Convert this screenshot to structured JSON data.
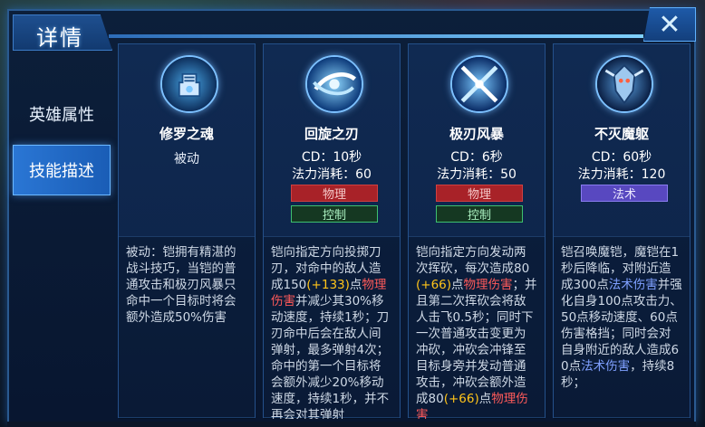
{
  "header": {
    "title": "详情",
    "close_icon": "close-x-icon"
  },
  "sidebar": {
    "tabs": [
      {
        "label": "英雄属性",
        "active": false
      },
      {
        "label": "技能描述",
        "active": true
      }
    ]
  },
  "skills": [
    {
      "name": "修罗之魂",
      "icon": "fist-soul-icon",
      "type": "被动",
      "desc": [
        {
          "t": "被动：铠拥有精湛的战斗技巧，当铠的普通攻击和极刃风暴只命中一个目标时将会额外造成50%伤害"
        }
      ]
    },
    {
      "name": "回旋之刃",
      "icon": "spinning-blade-icon",
      "cd": "CD：10秒",
      "cost": "法力消耗：60",
      "tags": [
        "物理",
        "控制"
      ],
      "desc": [
        {
          "t": "铠向指定方向投掷刀刃，对命中的敌人造成150"
        },
        {
          "t": "(+133)",
          "c": "y"
        },
        {
          "t": "点"
        },
        {
          "t": "物理伤害",
          "c": "r"
        },
        {
          "t": "并减少其30%移动速度，持续1秒；刀刃命中后会在敌人间弹射，最多弹射4次；命中的第一个目标将会额外减少20%移动速度，持续1秒，并不再会对其弹射"
        }
      ]
    },
    {
      "name": "极刃风暴",
      "icon": "blade-storm-icon",
      "cd": "CD：6秒",
      "cost": "法力消耗：50",
      "tags": [
        "物理",
        "控制"
      ],
      "desc": [
        {
          "t": "铠向指定方向发动两次挥砍，每次造成80"
        },
        {
          "t": "(+66)",
          "c": "y"
        },
        {
          "t": "点"
        },
        {
          "t": "物理伤害",
          "c": "r"
        },
        {
          "t": "；并且第二次挥砍会将敌人击飞0.5秒；同时下一次普通攻击变更为冲砍，冲砍会冲锋至目标身旁并发动普通攻击，冲砍会额外造成80"
        },
        {
          "t": "(+66)",
          "c": "y"
        },
        {
          "t": "点"
        },
        {
          "t": "物理伤害",
          "c": "r"
        }
      ]
    },
    {
      "name": "不灭魔躯",
      "icon": "armor-demon-icon",
      "cd": "CD：60秒",
      "cost": "法力消耗：120",
      "tags": [
        "法术"
      ],
      "desc": [
        {
          "t": "铠召唤魔铠，魔铠在1秒后降临，对附近造成300点"
        },
        {
          "t": "法术伤害",
          "c": "b"
        },
        {
          "t": "并强化自身100点攻击力、50点移动速度、60点伤害格挡；同时会对自身附近的敌人造成60点"
        },
        {
          "t": "法术伤害",
          "c": "b"
        },
        {
          "t": "，持续8秒；"
        }
      ]
    }
  ],
  "colors": {
    "accent": "#2a76d4",
    "physical": "#a82228",
    "control": "#3ec070",
    "magic": "#5848c0",
    "highlight_value": "#ffc41a",
    "highlight_physical": "#ff5a5a",
    "highlight_magic": "#7fa0ff"
  }
}
